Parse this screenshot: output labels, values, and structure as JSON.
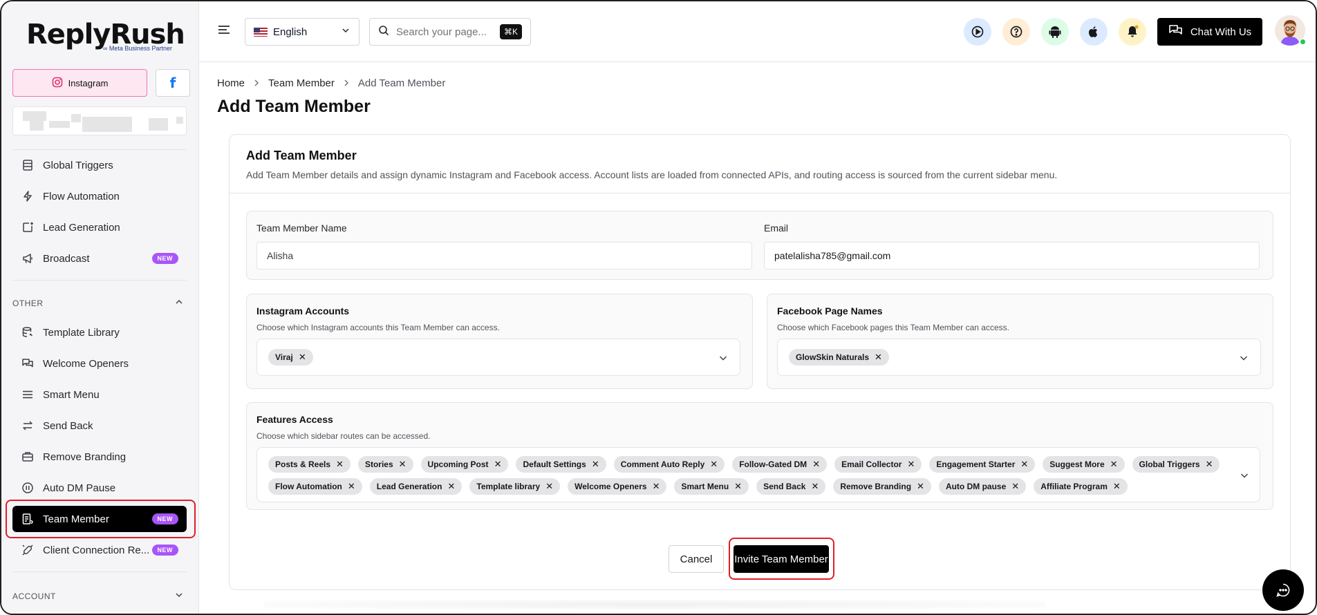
{
  "brand": {
    "name": "ReplyRush",
    "subtitle": "∞ Meta Business Partner"
  },
  "platforms": {
    "instagram": "Instagram",
    "facebook": "f"
  },
  "sidebar": {
    "items_top": [
      {
        "label": "Global Triggers",
        "icon": "global-triggers-icon"
      },
      {
        "label": "Flow Automation",
        "icon": "lightning-icon"
      },
      {
        "label": "Lead Generation",
        "icon": "lead-generation-icon"
      },
      {
        "label": "Broadcast",
        "icon": "megaphone-icon",
        "badge": "NEW"
      }
    ],
    "section_other": "OTHER",
    "items_other": [
      {
        "label": "Template Library",
        "icon": "database-icon"
      },
      {
        "label": "Welcome Openers",
        "icon": "chat-bubbles-icon"
      },
      {
        "label": "Smart Menu",
        "icon": "menu-lines-icon"
      },
      {
        "label": "Send Back",
        "icon": "arrows-exchange-icon"
      },
      {
        "label": "Remove Branding",
        "icon": "briefcase-icon"
      },
      {
        "label": "Auto DM Pause",
        "icon": "pause-icon"
      },
      {
        "label": "Team Member",
        "icon": "team-member-icon",
        "badge": "NEW",
        "active": true
      },
      {
        "label": "Client Connection Re...",
        "icon": "plug-icon",
        "badge": "NEW"
      }
    ],
    "section_account": "ACCOUNT"
  },
  "header": {
    "language": "English",
    "search_placeholder": "Search your page...",
    "search_shortcut": "⌘K",
    "chat_button": "Chat With Us",
    "icon_colors": [
      "#dbeafe",
      "#ffedd5",
      "#dcfce7",
      "#dbeafe",
      "#fef3c7"
    ]
  },
  "breadcrumb": {
    "home": "Home",
    "parent": "Team Member",
    "current": "Add Team Member"
  },
  "page_title": "Add Team Member",
  "form": {
    "title": "Add Team Member",
    "description": "Add Team Member details and assign dynamic Instagram and Facebook access. Account lists are loaded from connected APIs, and routing access is sourced from the current sidebar menu.",
    "name_label": "Team Member Name",
    "name_value": "Alisha",
    "email_label": "Email",
    "email_value": "patelalisha785@gmail.com",
    "instagram_label": "Instagram Accounts",
    "instagram_help": "Choose which Instagram accounts this Team Member can access.",
    "instagram_selected": [
      "Viraj"
    ],
    "facebook_label": "Facebook Page Names",
    "facebook_help": "Choose which Facebook pages this Team Member can access.",
    "facebook_selected": [
      "GlowSkin Naturals"
    ],
    "features_label": "Features Access",
    "features_help": "Choose which sidebar routes can be accessed.",
    "features_selected": [
      "Posts & Reels",
      "Stories",
      "Upcoming Post",
      "Default Settings",
      "Comment Auto Reply",
      "Follow-Gated DM",
      "Email Collector",
      "Engagement Starter",
      "Suggest More",
      "Global Triggers",
      "Flow Automation",
      "Lead Generation",
      "Template library",
      "Welcome Openers",
      "Smart Menu",
      "Send Back",
      "Remove Branding",
      "Auto DM pause",
      "Affiliate Program"
    ],
    "cancel_label": "Cancel",
    "invite_label": "Invite Team Member"
  },
  "colors": {
    "badge": "#a855f7",
    "highlight": "#e11d26",
    "instagram_tab_bg": "#fde7f1",
    "facebook": "#1877f2"
  }
}
